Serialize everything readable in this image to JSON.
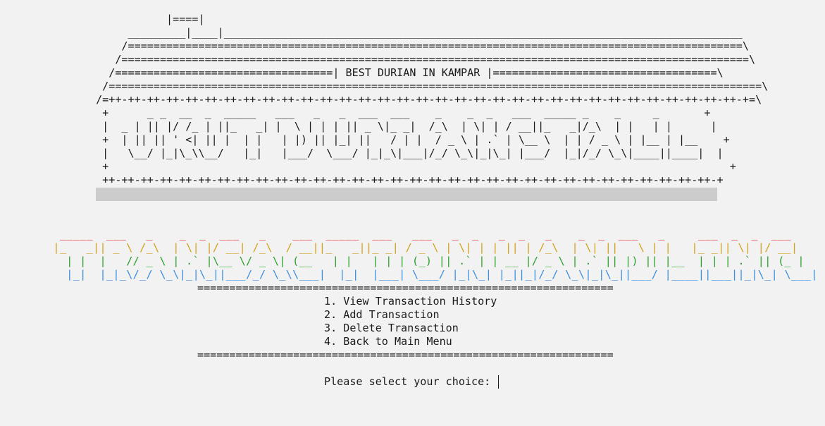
{
  "banner": {
    "art": "            |====|\n      _________|____|_________________________________________________________________________________\n     /================================================================================================\\\n    /==================================================================================================\\\n   /==================================| BEST DURIAN IN KAMPAR |===================================\\\n  /======================================================================================================\\\n /=++-++-++-++-++-++-++-++-++-++-++-++-++-++-++-++-++-++-++-++-++-++-++-++-++-++-++-++-++-++-++-++-++-+=\\\n  +      _ _  __  _  _____   ___   _   _  ___  ___    _    _  _   ___  _____ _    _     _       +\n  |  _ | || |/ /_ | ||_   _| |  \\ | | | || _ \\|_ _|  /_\\  | \\| | / __||_   _|/_\\  | |   | |      |\n  +  | || || ' <| || |  | |   | |) || |_| ||   / | |  / _ \\ | .` | \\__ \\  | | / _ \\ | |__ | |__    +\n  |   \\__/ |_|\\_\\\\__/   |_|   |___/  \\___/ |_|_\\|___|/_/ \\_\\|_|\\_| |___/  |_|/_/ \\_\\|____||____|  |\n  +                                                                                                 +\n  ++-++-++-++-++-++-++-++-++-++-++-++-++-++-++-++-++-++-++-++-++-++-++-++-++-++-++-++-++-++-++-++-+",
    "gray_bar_color": "#cccccc"
  },
  "title_art": {
    "lines": [
      "  _____  ___   _    _  _  ___   _    ___  _____  ___   ___   _  _   _  _   _    _  _  ___   _     ___  _  _  ___",
      " |_   _|| _ \\ /_\\  | \\| |/ __| /_\\  / __||_   _||_ _| / _ \\ | \\| | | || | /_\\  | \\| ||   \\ | |   |_ _|| \\| |/ __|",
      "   | |  |   // _ \\ | .` |\\__ \\/ _ \\| (__   | |   | | | (_) || .` | | __ |/ _ \\ | .` || |) || |__  | | | .` || (_ |",
      "   |_|  |_|_\\/_/ \\_\\|_|\\_||___/_/ \\_\\\\___|  |_|  |___| \\___/ |_|\\_| |_||_|/_/ \\_\\|_|\\_||___/ |____||___||_|\\_| \\___|"
    ],
    "colors": [
      "#e0202a",
      "#d4a017",
      "#2aa02a",
      "#3a8ee0"
    ]
  },
  "rule": "=================================================================",
  "menu": {
    "options": [
      "1. View Transaction History",
      "2. Add Transaction",
      "3. Delete Transaction",
      "4. Back to Main Menu"
    ]
  },
  "prompt": {
    "label": "Please select your choice: ",
    "value": ""
  }
}
